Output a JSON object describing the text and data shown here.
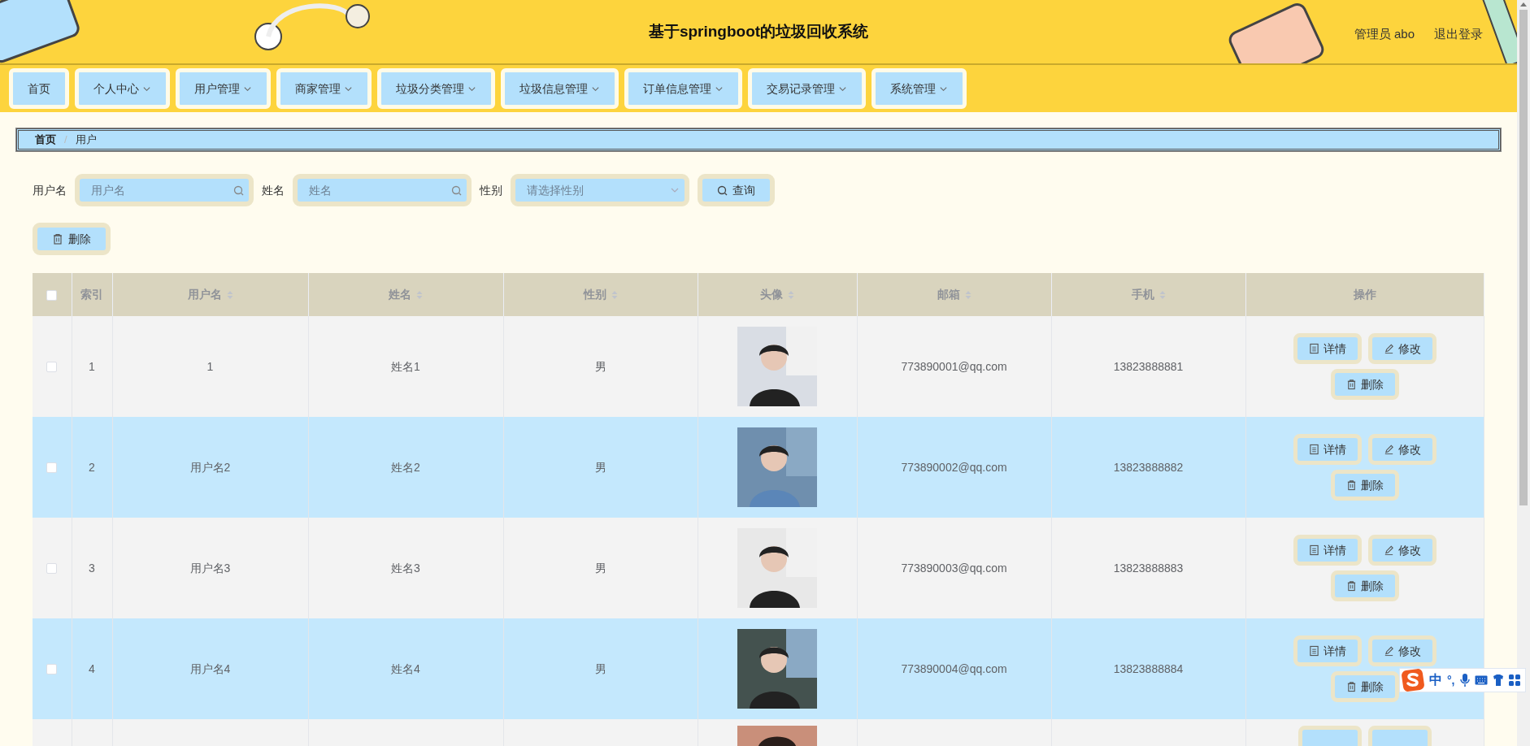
{
  "header": {
    "title": "基于springboot的垃圾回收系统",
    "user": "管理员 abo",
    "logout": "退出登录"
  },
  "nav": [
    {
      "label": "首页",
      "dropdown": false
    },
    {
      "label": "个人中心",
      "dropdown": true
    },
    {
      "label": "用户管理",
      "dropdown": true
    },
    {
      "label": "商家管理",
      "dropdown": true
    },
    {
      "label": "垃圾分类管理",
      "dropdown": true
    },
    {
      "label": "垃圾信息管理",
      "dropdown": true
    },
    {
      "label": "订单信息管理",
      "dropdown": true
    },
    {
      "label": "交易记录管理",
      "dropdown": true
    },
    {
      "label": "系统管理",
      "dropdown": true
    }
  ],
  "breadcrumb": {
    "items": [
      "首页",
      "用户"
    ],
    "separator": "/"
  },
  "search": {
    "fields": [
      {
        "label": "用户名",
        "placeholder": "用户名",
        "kind": "text"
      },
      {
        "label": "姓名",
        "placeholder": "姓名",
        "kind": "text"
      },
      {
        "label": "性别",
        "placeholder": "请选择性别",
        "kind": "select"
      }
    ],
    "query_button": "查询"
  },
  "delete_button": "删除",
  "table": {
    "select_all": {
      "checked": false
    },
    "columns": [
      {
        "label": "索引",
        "sortable": false
      },
      {
        "label": "用户名",
        "sortable": true
      },
      {
        "label": "姓名",
        "sortable": true
      },
      {
        "label": "性别",
        "sortable": true
      },
      {
        "label": "头像",
        "sortable": true
      },
      {
        "label": "邮箱",
        "sortable": true
      },
      {
        "label": "手机",
        "sortable": true
      },
      {
        "label": "操作",
        "sortable": false
      }
    ],
    "rows": [
      {
        "checked": false,
        "index": "1",
        "username": "1",
        "name": "姓名1",
        "gender": "男",
        "avatar": {
          "kind": "picture"
        },
        "email": "773890001@qq.com",
        "phone": "13823888881",
        "actions": [
          {
            "label": "详情",
            "kind": "detail"
          },
          {
            "label": "修改",
            "kind": "edit"
          },
          {
            "label": "删除",
            "kind": "delete"
          }
        ]
      },
      {
        "checked": false,
        "index": "2",
        "username": "用户名2",
        "name": "姓名2",
        "gender": "男",
        "avatar": {
          "kind": "picture"
        },
        "email": "773890002@qq.com",
        "phone": "13823888882",
        "actions": [
          {
            "label": "详情",
            "kind": "detail"
          },
          {
            "label": "修改",
            "kind": "edit"
          },
          {
            "label": "删除",
            "kind": "delete"
          }
        ]
      },
      {
        "checked": false,
        "index": "3",
        "username": "用户名3",
        "name": "姓名3",
        "gender": "男",
        "avatar": {
          "kind": "picture"
        },
        "email": "773890003@qq.com",
        "phone": "13823888883",
        "actions": [
          {
            "label": "详情",
            "kind": "detail"
          },
          {
            "label": "修改",
            "kind": "edit"
          },
          {
            "label": "删除",
            "kind": "delete"
          }
        ]
      },
      {
        "checked": false,
        "index": "4",
        "username": "用户名4",
        "name": "姓名4",
        "gender": "男",
        "avatar": {
          "kind": "picture"
        },
        "email": "773890004@qq.com",
        "phone": "13823888884",
        "actions": [
          {
            "label": "详情",
            "kind": "detail"
          },
          {
            "label": "修改",
            "kind": "edit"
          },
          {
            "label": "删除",
            "kind": "delete"
          }
        ]
      }
    ],
    "more_rows_below": true
  },
  "ime_toolbar": {
    "mode": "中",
    "punctuation": "°,"
  }
}
